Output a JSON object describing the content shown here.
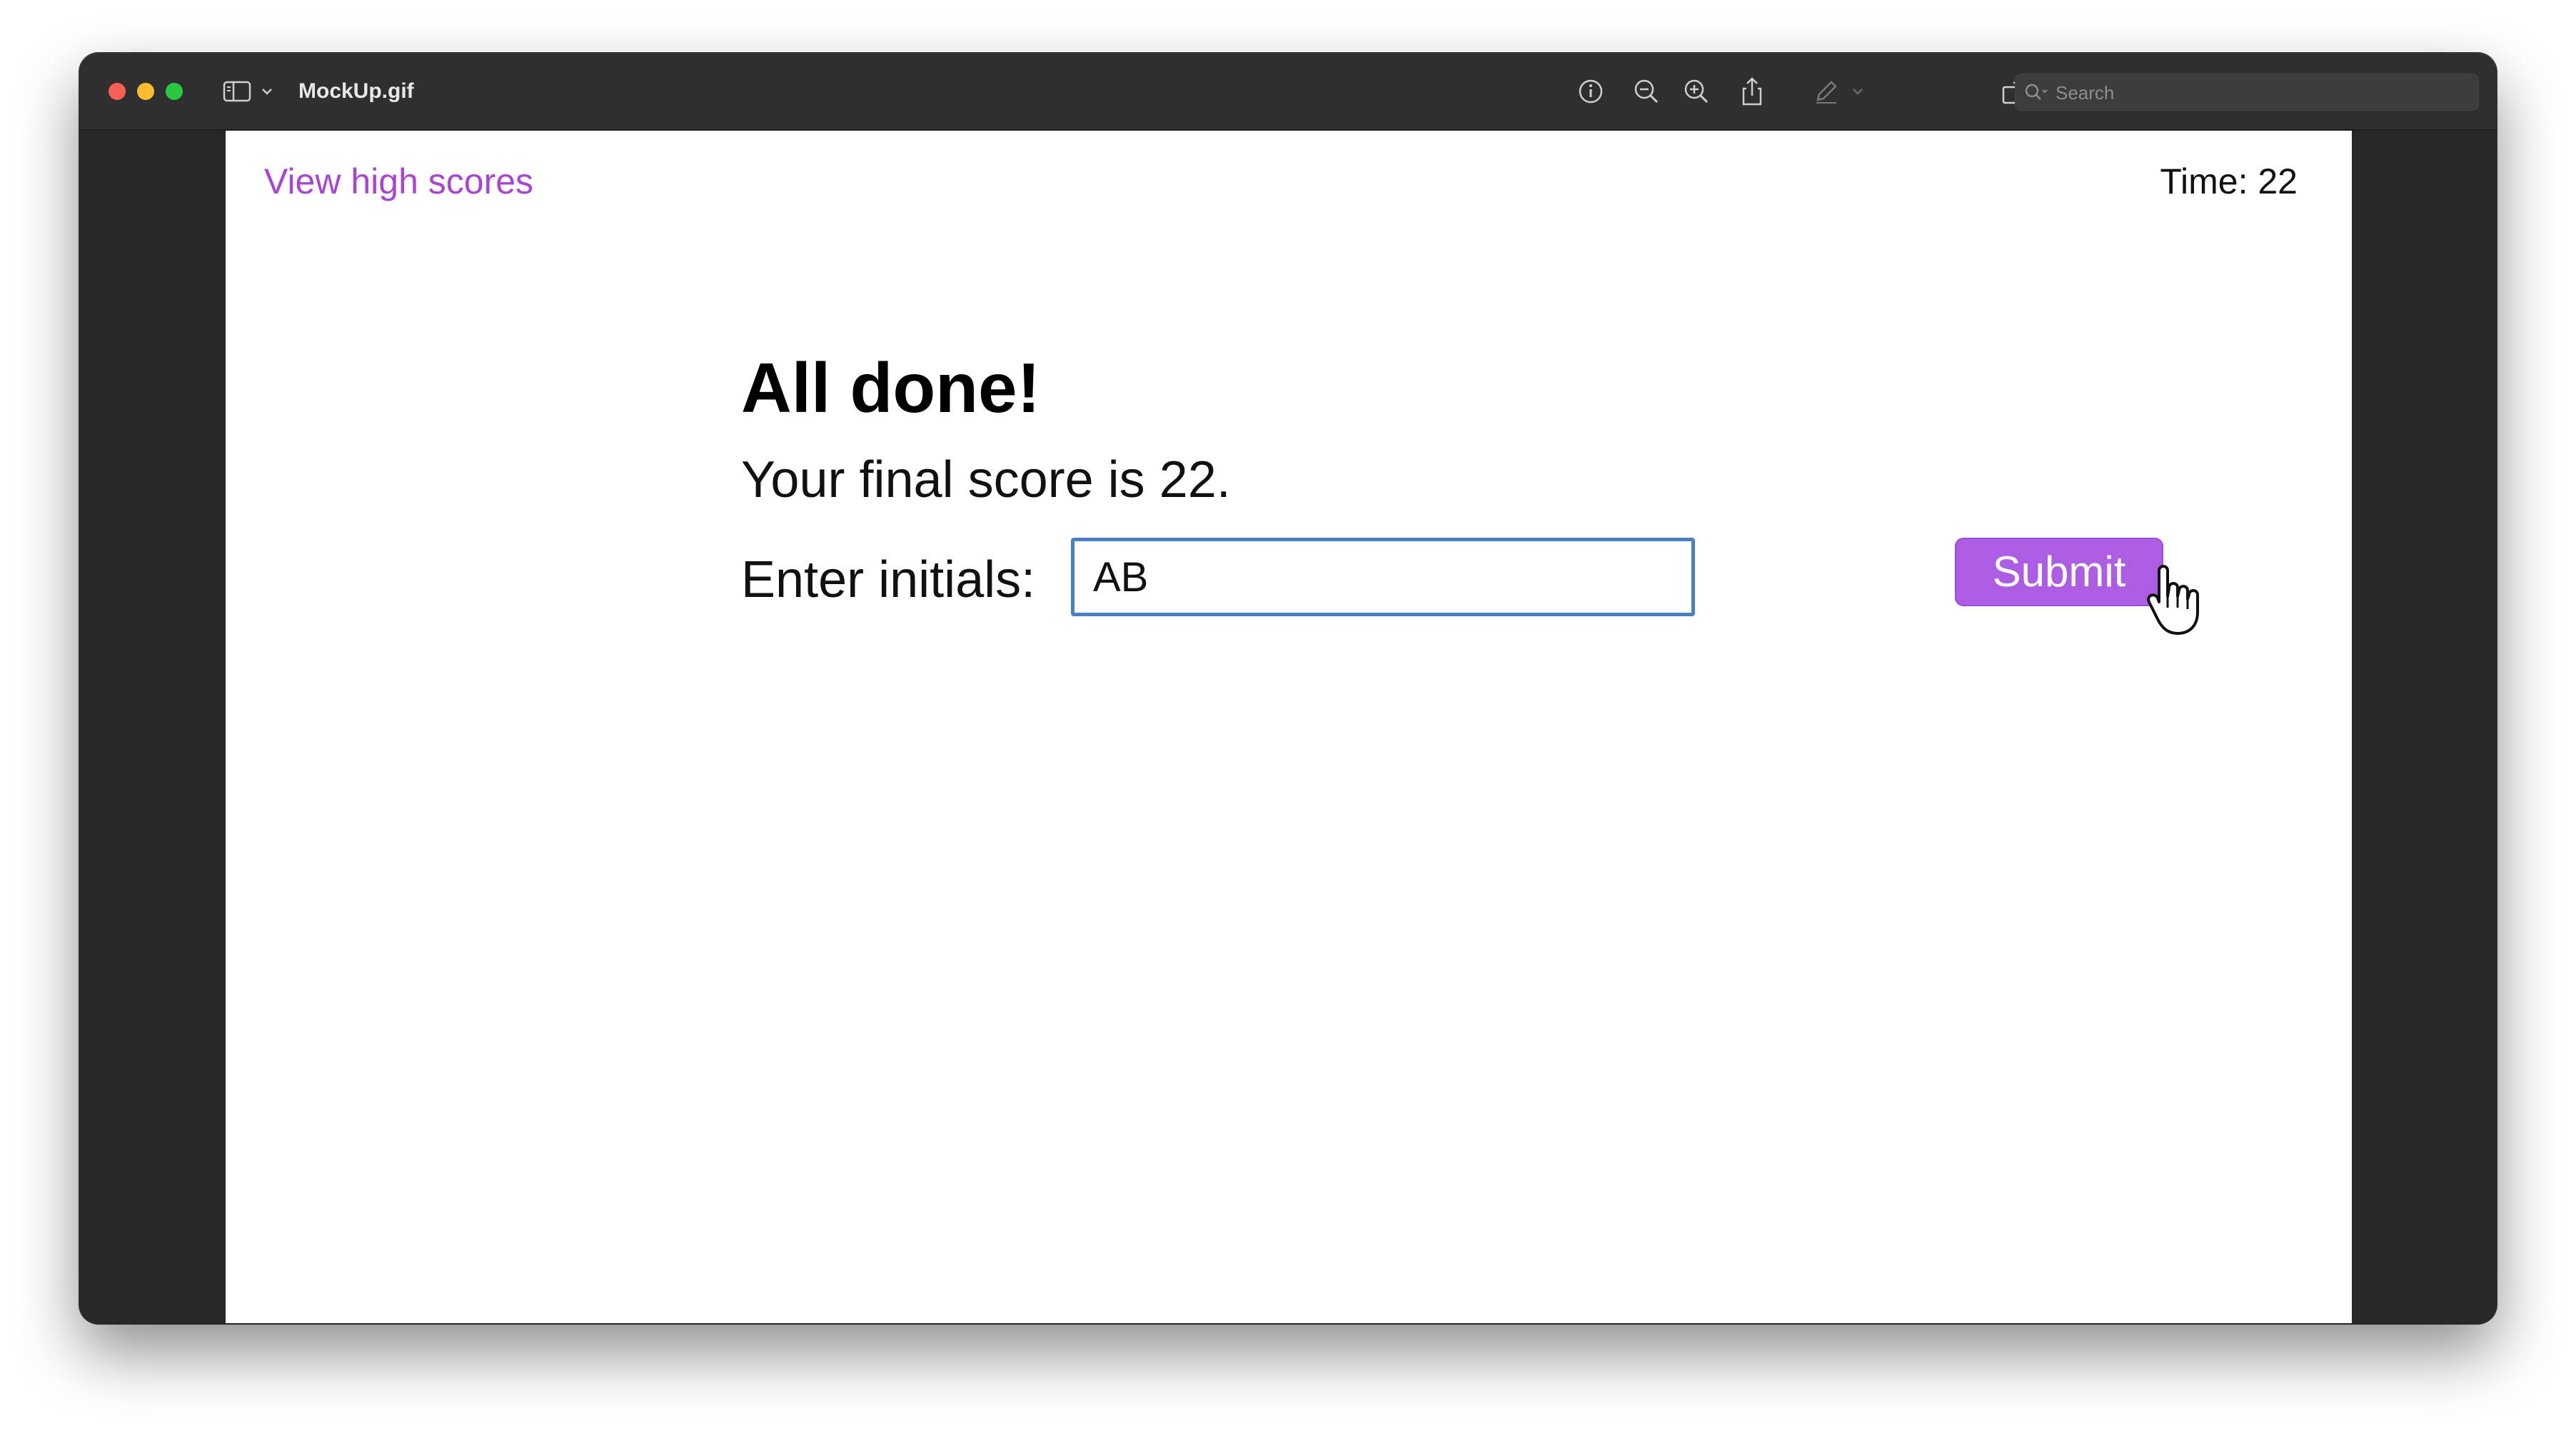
{
  "window": {
    "title": "MockUp.gif",
    "toolbar_icons": [
      "sidebar-toggle-icon",
      "chevron-down-icon",
      "info-icon",
      "zoom-out-icon",
      "zoom-in-icon",
      "share-icon",
      "markup-pen-icon",
      "chevron-down-icon",
      "rotate-icon",
      "annotate-icon",
      "search-icon"
    ],
    "search_placeholder": "Search"
  },
  "page": {
    "high_scores_link": "View high scores",
    "timer_label": "Time:",
    "timer_value": "22",
    "heading": "All done!",
    "score_prefix": "Your final score is",
    "score_value": "22.",
    "initials_label": "Enter initials:",
    "initials_value": "AB",
    "submit_label": "Submit"
  },
  "colors": {
    "accent": "#ad5de3",
    "link": "#a846d4",
    "input_border": "#4a7fc1"
  }
}
